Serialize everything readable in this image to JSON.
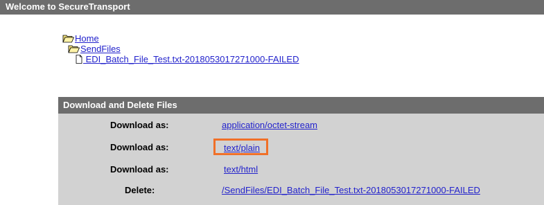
{
  "header": {
    "title": "Welcome to SecureTransport"
  },
  "tree": {
    "home": "Home",
    "folder": "SendFiles",
    "file": " EDI_Batch_File_Test.txt-2018053017271000-FAILED"
  },
  "panel": {
    "title": "Download and Delete Files",
    "rows": [
      {
        "label": "Download as:",
        "value": "application/octet-stream"
      },
      {
        "label": "Download as:",
        "value": "text/plain"
      },
      {
        "label": "Download as:",
        "value": "text/html"
      },
      {
        "label": "Delete:",
        "value": "/SendFiles/EDI_Batch_File_Test.txt-2018053017271000-FAILED"
      }
    ]
  },
  "colors": {
    "bar": "#6d6d6d",
    "panel": "#d2d2d2",
    "highlight": "#f07028",
    "link": "#2222cc"
  },
  "icons": {
    "home": "folder-open-icon",
    "folder": "folder-open-icon",
    "file": "file-icon"
  }
}
